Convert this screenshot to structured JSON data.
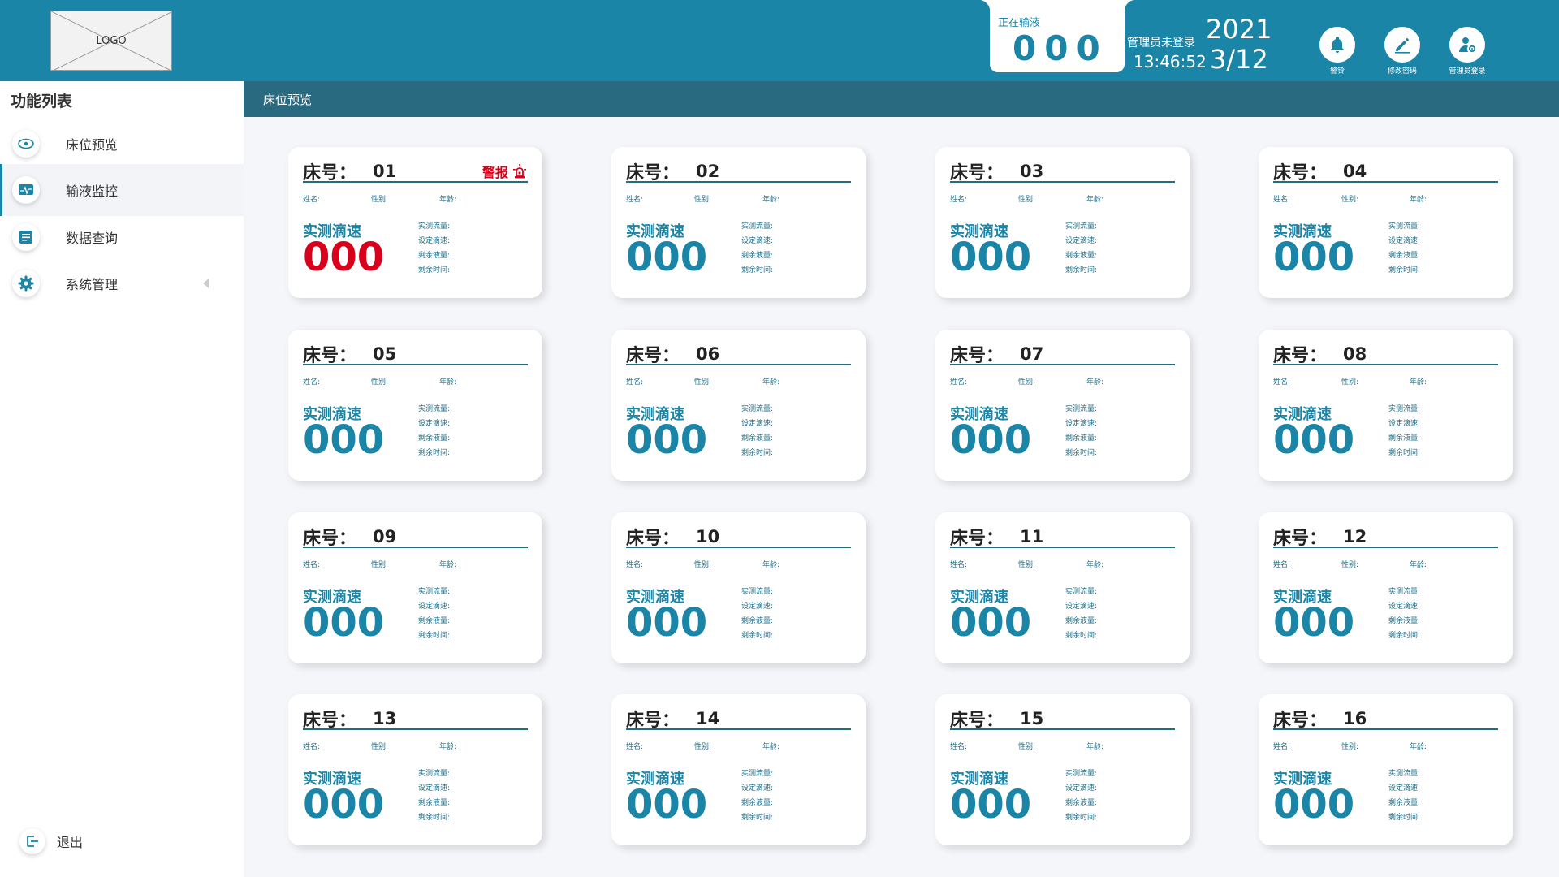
{
  "header": {
    "logo": "LOGO",
    "infusing_label": "正在输液",
    "infusing_count": "000",
    "admin_status": "管理员未登录",
    "time": "13:46:52",
    "year": "2021",
    "month_day": "3/12",
    "buttons": [
      {
        "label": "警铃",
        "icon": "bell-icon"
      },
      {
        "label": "修改密码",
        "icon": "pencil-icon"
      },
      {
        "label": "管理员登录",
        "icon": "admin-user-icon"
      }
    ]
  },
  "sidebar": {
    "title": "功能列表",
    "items": [
      {
        "label": "床位预览",
        "icon": "eye-icon"
      },
      {
        "label": "输液监控",
        "icon": "monitor-icon",
        "active": true
      },
      {
        "label": "数据查询",
        "icon": "document-icon"
      },
      {
        "label": "系统管理",
        "icon": "gear-icon"
      }
    ],
    "logout": "退出"
  },
  "breadcrumb": "床位预览",
  "card_labels": {
    "bed": "床号：",
    "name": "姓名:",
    "gender": "性别:",
    "age": "年龄:",
    "rate": "实测滴速",
    "measured_flow": "实测流量:",
    "set_rate": "设定滴速:",
    "remaining_volume": "剩余液量:",
    "remaining_time": "剩余时间:",
    "alarm": "警报"
  },
  "colors": {
    "primary": "#1a85a6",
    "alarm": "#d9001b",
    "breadcrumb": "#2a6a80"
  },
  "beds": [
    {
      "number": "01",
      "rate": "000",
      "alarm": true
    },
    {
      "number": "02",
      "rate": "000",
      "alarm": false
    },
    {
      "number": "03",
      "rate": "000",
      "alarm": false
    },
    {
      "number": "04",
      "rate": "000",
      "alarm": false
    },
    {
      "number": "05",
      "rate": "000",
      "alarm": false
    },
    {
      "number": "06",
      "rate": "000",
      "alarm": false
    },
    {
      "number": "07",
      "rate": "000",
      "alarm": false
    },
    {
      "number": "08",
      "rate": "000",
      "alarm": false
    },
    {
      "number": "09",
      "rate": "000",
      "alarm": false
    },
    {
      "number": "10",
      "rate": "000",
      "alarm": false
    },
    {
      "number": "11",
      "rate": "000",
      "alarm": false
    },
    {
      "number": "12",
      "rate": "000",
      "alarm": false
    },
    {
      "number": "13",
      "rate": "000",
      "alarm": false
    },
    {
      "number": "14",
      "rate": "000",
      "alarm": false
    },
    {
      "number": "15",
      "rate": "000",
      "alarm": false
    },
    {
      "number": "16",
      "rate": "000",
      "alarm": false
    }
  ]
}
